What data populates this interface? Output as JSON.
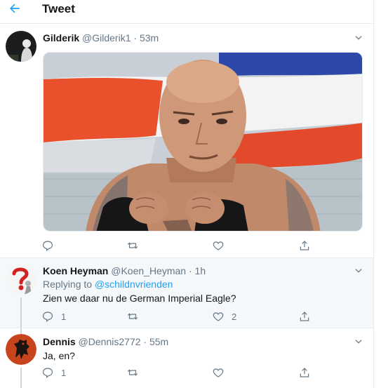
{
  "header": {
    "title": "Tweet",
    "back_icon": "arrow-left-icon",
    "accent": "#1da1f2"
  },
  "main_tweet": {
    "name": "Gilderik",
    "handle": "@Gilderik1",
    "separator": "·",
    "time": "53m",
    "media": "photo of a bald shirtless fighter with wrapped hands in front of a red-white-blue flag",
    "actions": {
      "reply": "",
      "retweet": "",
      "like": "",
      "share": ""
    }
  },
  "replies": [
    {
      "name": "Koen Heyman",
      "handle": "@Koen_Heyman",
      "separator": "·",
      "time": "1h",
      "replying_prefix": "Replying to ",
      "replying_to": "@schildnvrienden",
      "text": "Zien we daar nu de German Imperial Eagle?",
      "reply_count": "1",
      "retweet_count": "",
      "like_count": "2"
    },
    {
      "name": "Dennis",
      "handle": "@Dennis2772",
      "separator": "·",
      "time": "55m",
      "text": "Ja, en?",
      "reply_count": "1",
      "retweet_count": "",
      "like_count": ""
    }
  ],
  "colors": {
    "muted": "#657786",
    "text": "#14171a",
    "link": "#1da1f2",
    "border": "#e6ecf0"
  }
}
